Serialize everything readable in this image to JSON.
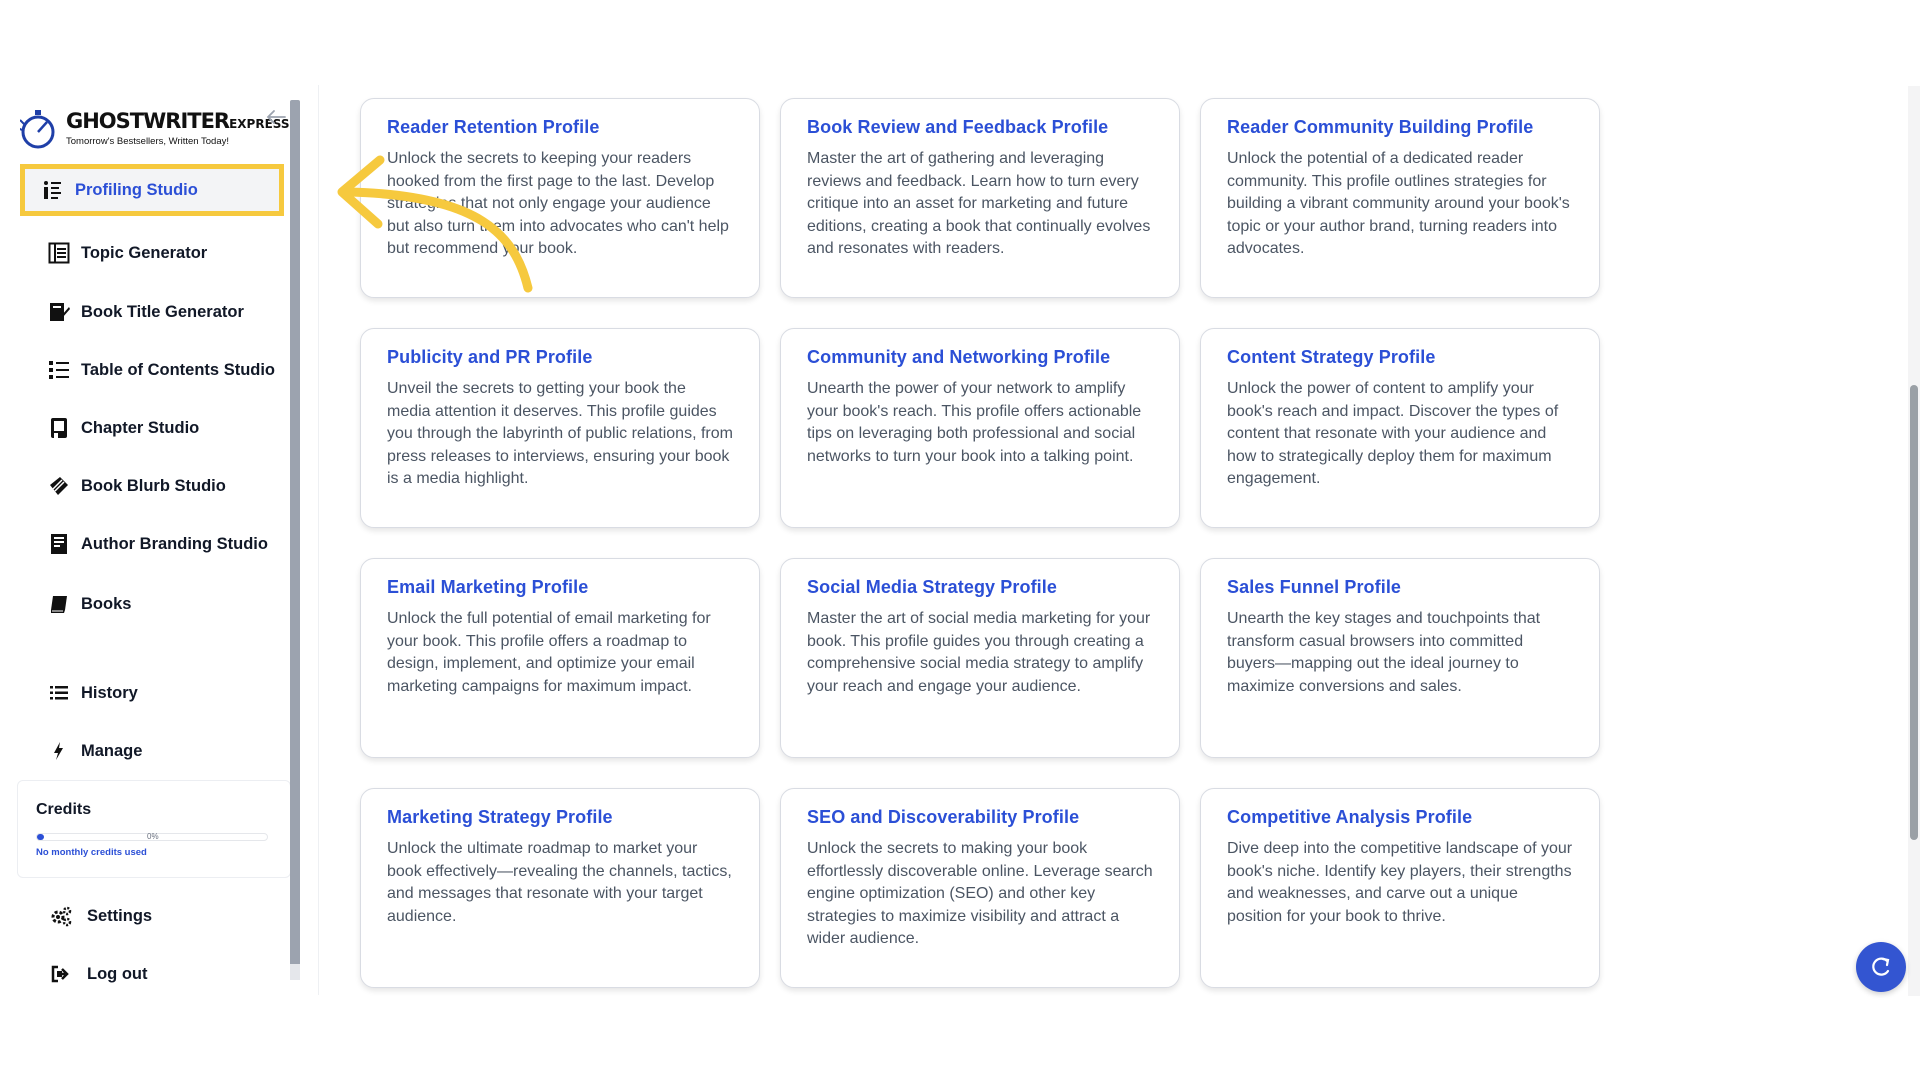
{
  "brand": {
    "name_main": "GHOSTWRITER",
    "name_suffix": "EXPRESS",
    "tagline": "Tomorrow's Bestsellers, Written Today!"
  },
  "sidebar": {
    "collapse_icon": "arrow-left-icon",
    "items": [
      {
        "label": "Profiling Studio",
        "icon": "profiling-icon",
        "active": true
      },
      {
        "label": "Topic Generator",
        "icon": "topic-icon"
      },
      {
        "label": "Book Title Generator",
        "icon": "title-icon"
      },
      {
        "label": "Table of Contents Studio",
        "icon": "toc-icon"
      },
      {
        "label": "Chapter Studio",
        "icon": "chapter-icon"
      },
      {
        "label": "Book Blurb Studio",
        "icon": "blurb-icon"
      },
      {
        "label": "Author Branding Studio",
        "icon": "branding-icon"
      },
      {
        "label": "Books",
        "icon": "book-icon"
      },
      {
        "label": "History",
        "icon": "list-icon"
      },
      {
        "label": "Manage",
        "icon": "bolt-icon"
      }
    ],
    "credits": {
      "title": "Credits",
      "percent_label": "0%",
      "percent_value": 0.02,
      "note": "No monthly credits used"
    },
    "bottom": [
      {
        "label": "Settings",
        "icon": "gears-icon"
      },
      {
        "label": "Log out",
        "icon": "logout-icon"
      }
    ]
  },
  "cards": [
    {
      "title": "Reader Retention Profile",
      "desc": "Unlock the secrets to keeping your readers hooked from the first page to the last. Develop strategies that not only engage your audience but also turn them into advocates who can't help but recommend your book."
    },
    {
      "title": "Book Review and Feedback Profile",
      "desc": "Master the art of gathering and leveraging reviews and feedback. Learn how to turn every critique into an asset for marketing and future editions, creating a book that continually evolves and resonates with readers."
    },
    {
      "title": "Reader Community Building Profile",
      "desc": "Unlock the potential of a dedicated reader community. This profile outlines strategies for building a vibrant community around your book's topic or your author brand, turning readers into advocates."
    },
    {
      "title": "Publicity and PR Profile",
      "desc": "Unveil the secrets to getting your book the media attention it deserves. This profile guides you through the labyrinth of public relations, from press releases to interviews, ensuring your book is a media highlight."
    },
    {
      "title": "Community and Networking Profile",
      "desc": "Unearth the power of your network to amplify your book's reach. This profile offers actionable tips on leveraging both professional and social networks to turn your book into a talking point."
    },
    {
      "title": "Content Strategy Profile",
      "desc": "Unlock the power of content to amplify your book's reach and impact. Discover the types of content that resonate with your audience and how to strategically deploy them for maximum engagement."
    },
    {
      "title": "Email Marketing Profile",
      "desc": "Unlock the full potential of email marketing for your book. This profile offers a roadmap to design, implement, and optimize your email marketing campaigns for maximum impact."
    },
    {
      "title": "Social Media Strategy Profile",
      "desc": "Master the art of social media marketing for your book. This profile guides you through creating a comprehensive social media strategy to amplify your reach and engage your audience."
    },
    {
      "title": "Sales Funnel Profile",
      "desc": "Unearth the key stages and touchpoints that transform casual browsers into committed buyers—mapping out the ideal journey to maximize conversions and sales."
    },
    {
      "title": "Marketing Strategy Profile",
      "desc": "Unlock the ultimate roadmap to market your book effectively—revealing the channels, tactics, and messages that resonate with your target audience."
    },
    {
      "title": "SEO and Discoverability Profile",
      "desc": "Unlock the secrets to making your book effortlessly discoverable online. Leverage search engine optimization (SEO) and other key strategies to maximize visibility and attract a wider audience."
    },
    {
      "title": "Competitive Analysis Profile",
      "desc": "Dive deep into the competitive landscape of your book's niche. Identify key players, their strengths and weaknesses, and carve out a unique position for your book to thrive."
    }
  ],
  "colors": {
    "accent": "#2b4fd6",
    "highlight": "#f6c93e"
  },
  "fab_icon": "refresh-icon"
}
